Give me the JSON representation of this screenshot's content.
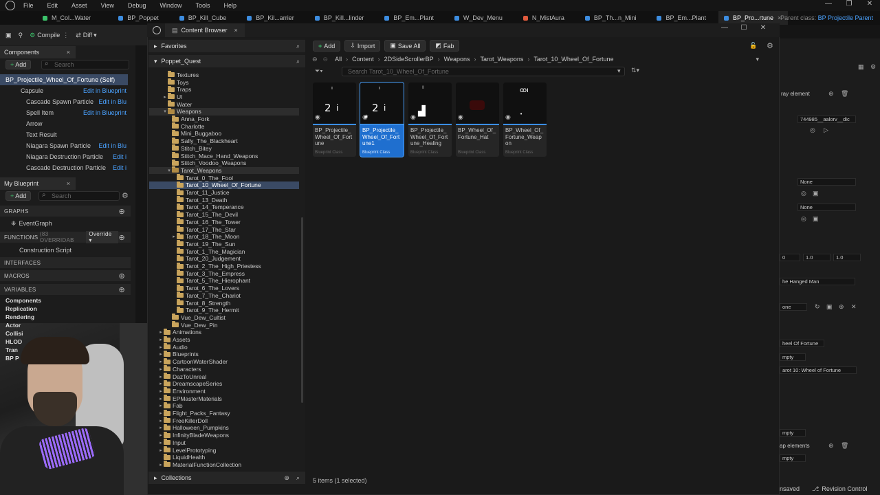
{
  "menu": [
    "File",
    "Edit",
    "Asset",
    "View",
    "Debug",
    "Window",
    "Tools",
    "Help"
  ],
  "tabs": [
    {
      "label": "M_Col...Water",
      "active": false
    },
    {
      "label": "BP_Poppet",
      "active": false
    },
    {
      "label": "BP_Kill_Cube",
      "active": false
    },
    {
      "label": "BP_Kil...arrier",
      "active": false
    },
    {
      "label": "BP_Kill...linder",
      "active": false
    },
    {
      "label": "BP_Em...Plant",
      "active": false
    },
    {
      "label": "W_Dev_Menu",
      "active": false
    },
    {
      "label": "N_MistAura",
      "active": false
    },
    {
      "label": "BP_Th...n_Mini",
      "active": false
    },
    {
      "label": "BP_Em...Plant",
      "active": false
    },
    {
      "label": "BP_Pro...rtune",
      "active": true
    }
  ],
  "parent_class": {
    "label": "Parent class:",
    "value": "BP Projectile Parent"
  },
  "toolbar": {
    "compile": "Compile",
    "diff": "Diff"
  },
  "components": {
    "title": "Components",
    "add": "Add",
    "search_placeholder": "Search",
    "root": "BP_Projectile_Wheel_Of_Fortune (Self)",
    "items": [
      {
        "name": "Capsule",
        "link": "Edit in Blueprint"
      },
      {
        "name": "Cascade Spawn Particle",
        "link": "Edit in Blu"
      },
      {
        "name": "Spell Item",
        "link": "Edit in Blueprint"
      },
      {
        "name": "Arrow",
        "link": ""
      },
      {
        "name": "Text Result",
        "link": ""
      },
      {
        "name": "Niagara Spawn Particle",
        "link": "Edit in Blu"
      },
      {
        "name": "Niagara Destruction Particle",
        "link": "Edit i"
      },
      {
        "name": "Cascade Destruction Particle",
        "link": "Edit i"
      }
    ]
  },
  "my_blueprint": {
    "title": "My Blueprint",
    "add": "Add",
    "search_placeholder": "Search",
    "graphs": "GRAPHS",
    "event_graph": "EventGraph",
    "functions": "FUNCTIONS",
    "functions_count": "(83 OVERRIDAB",
    "override": "Override",
    "construction": "Construction Script",
    "interfaces": "INTERFACES",
    "macros": "MACROS",
    "variables": "VARIABLES",
    "var_groups": [
      "Components",
      "Replication",
      "Rendering",
      "Actor",
      "Collisi",
      "HLOD",
      "Tran",
      "BP P"
    ]
  },
  "content_browser": {
    "title": "Content Browser",
    "favorites": "Favorites",
    "project": "Poppet_Quest",
    "collections": "Collections",
    "tree": [
      {
        "label": "Textures",
        "indent": 0,
        "arrow": ""
      },
      {
        "label": "Toys",
        "indent": 0,
        "arrow": ""
      },
      {
        "label": "Traps",
        "indent": 0,
        "arrow": ""
      },
      {
        "label": "UI",
        "indent": 0,
        "arrow": "▸"
      },
      {
        "label": "Water",
        "indent": 0,
        "arrow": ""
      },
      {
        "label": "Weapons",
        "indent": 0,
        "arrow": "▾",
        "hl": true
      },
      {
        "label": "Anna_Fork",
        "indent": 1,
        "arrow": ""
      },
      {
        "label": "Charlotte",
        "indent": 1,
        "arrow": ""
      },
      {
        "label": "Mini_Buggaboo",
        "indent": 1,
        "arrow": ""
      },
      {
        "label": "Sally_The_Blackheart",
        "indent": 1,
        "arrow": ""
      },
      {
        "label": "Stitch_Bitey",
        "indent": 1,
        "arrow": ""
      },
      {
        "label": "Stitch_Mace_Hand_Weapons",
        "indent": 1,
        "arrow": ""
      },
      {
        "label": "Stitch_Voodoo_Weapons",
        "indent": 1,
        "arrow": ""
      },
      {
        "label": "Tarot_Weapons",
        "indent": 1,
        "arrow": "▾",
        "hl": true
      },
      {
        "label": "Tarot_0_The_Fool",
        "indent": 2,
        "arrow": ""
      },
      {
        "label": "Tarot_10_Wheel_Of_Fortune",
        "indent": 2,
        "arrow": "",
        "sel": true
      },
      {
        "label": "Tarot_11_Justice",
        "indent": 2,
        "arrow": ""
      },
      {
        "label": "Tarot_13_Death",
        "indent": 2,
        "arrow": ""
      },
      {
        "label": "Tarot_14_Temperance",
        "indent": 2,
        "arrow": ""
      },
      {
        "label": "Tarot_15_The_Devil",
        "indent": 2,
        "arrow": ""
      },
      {
        "label": "Tarot_16_The_Tower",
        "indent": 2,
        "arrow": ""
      },
      {
        "label": "Tarot_17_The_Star",
        "indent": 2,
        "arrow": ""
      },
      {
        "label": "Tarot_18_The_Moon",
        "indent": 2,
        "arrow": "▸"
      },
      {
        "label": "Tarot_19_The_Sun",
        "indent": 2,
        "arrow": ""
      },
      {
        "label": "Tarot_1_The_Magician",
        "indent": 2,
        "arrow": ""
      },
      {
        "label": "Tarot_20_Judgement",
        "indent": 2,
        "arrow": ""
      },
      {
        "label": "Tarot_2_The_High_Priestess",
        "indent": 2,
        "arrow": ""
      },
      {
        "label": "Tarot_3_The_Empress",
        "indent": 2,
        "arrow": ""
      },
      {
        "label": "Tarot_5_The_Hierophant",
        "indent": 2,
        "arrow": ""
      },
      {
        "label": "Tarot_6_The_Lovers",
        "indent": 2,
        "arrow": ""
      },
      {
        "label": "Tarot_7_The_Chariot",
        "indent": 2,
        "arrow": ""
      },
      {
        "label": "Tarot_8_Strength",
        "indent": 2,
        "arrow": ""
      },
      {
        "label": "Tarot_9_The_Hermit",
        "indent": 2,
        "arrow": ""
      },
      {
        "label": "Vue_Dew_Cultist",
        "indent": 1,
        "arrow": ""
      },
      {
        "label": "Vue_Dew_Pin",
        "indent": 1,
        "arrow": ""
      },
      {
        "label": "Animations",
        "indent": -1,
        "arrow": "▸"
      },
      {
        "label": "Assets",
        "indent": -1,
        "arrow": "▸"
      },
      {
        "label": "Audio",
        "indent": -1,
        "arrow": "▸"
      },
      {
        "label": "Blueprints",
        "indent": -1,
        "arrow": "▸"
      },
      {
        "label": "CartoonWaterShader",
        "indent": -1,
        "arrow": "▸"
      },
      {
        "label": "Characters",
        "indent": -1,
        "arrow": "▸"
      },
      {
        "label": "DazToUnreal",
        "indent": -1,
        "arrow": "▸"
      },
      {
        "label": "DreamscapeSeries",
        "indent": -1,
        "arrow": "▸"
      },
      {
        "label": "Environment",
        "indent": -1,
        "arrow": "▸"
      },
      {
        "label": "EPMasterMaterials",
        "indent": -1,
        "arrow": "▸"
      },
      {
        "label": "Fab",
        "indent": -1,
        "arrow": "▸"
      },
      {
        "label": "Flight_Packs_Fantasy",
        "indent": -1,
        "arrow": "▸"
      },
      {
        "label": "FreeKillerDoll",
        "indent": -1,
        "arrow": "▸"
      },
      {
        "label": "Halloween_Pumpkins",
        "indent": -1,
        "arrow": "▸"
      },
      {
        "label": "InfinityBladeWeapons",
        "indent": -1,
        "arrow": "▸"
      },
      {
        "label": "Input",
        "indent": -1,
        "arrow": "▸"
      },
      {
        "label": "LevelPrototyping",
        "indent": -1,
        "arrow": "▸"
      },
      {
        "label": "LiquidHealth",
        "indent": -1,
        "arrow": ""
      },
      {
        "label": "MaterialFunctionCollection",
        "indent": -1,
        "arrow": "▸"
      }
    ],
    "buttons": {
      "add": "Add",
      "import": "Import",
      "save_all": "Save All",
      "fab": "Fab"
    },
    "path": [
      "All",
      "Content",
      "2DSideScrollerBP",
      "Weapons",
      "Tarot_Weapons",
      "Tarot_10_Wheel_Of_Fortune"
    ],
    "search_placeholder": "Search Tarot_10_Wheel_Of_Fortune",
    "assets": [
      {
        "name": "BP_Projectile_Wheel_Of_Fortune",
        "type": "Blueprint Class",
        "selected": false
      },
      {
        "name": "BP_Projectile_Wheel_Of_Fortune1",
        "type": "Blueprint Class",
        "selected": true
      },
      {
        "name": "BP_Projectile_Wheel_Of_Fortune_Healing",
        "type": "Blueprint Class",
        "selected": false
      },
      {
        "name": "BP_Wheel_Of_Fortune_Hat",
        "type": "Blueprint Class",
        "selected": false
      },
      {
        "name": "BP_Wheel_Of_Fortune_Weapon",
        "type": "Blueprint Class",
        "selected": false
      }
    ],
    "status": "5 items (1 selected)"
  },
  "details": {
    "array_element": "ray element",
    "asset_ref": "744985__aalorv__dic",
    "none1": "None",
    "none2": "None",
    "vec": [
      "0",
      "1.0",
      "1.0"
    ],
    "hanged": "he Hanged Man",
    "none3": "one",
    "wheel": "heel Of Fortune",
    "empty1": "mpty",
    "tarot_text": "arot 10: Wheel of Fortune",
    "empty2": "mpty",
    "map_elements": "ap elements",
    "empty3": "mpty",
    "unsaved": "nsaved",
    "revision": "Revision Control"
  },
  "colors": {
    "accent": "#1f6fcf",
    "link": "#4aa2ff",
    "folder": "#c9a45c"
  }
}
